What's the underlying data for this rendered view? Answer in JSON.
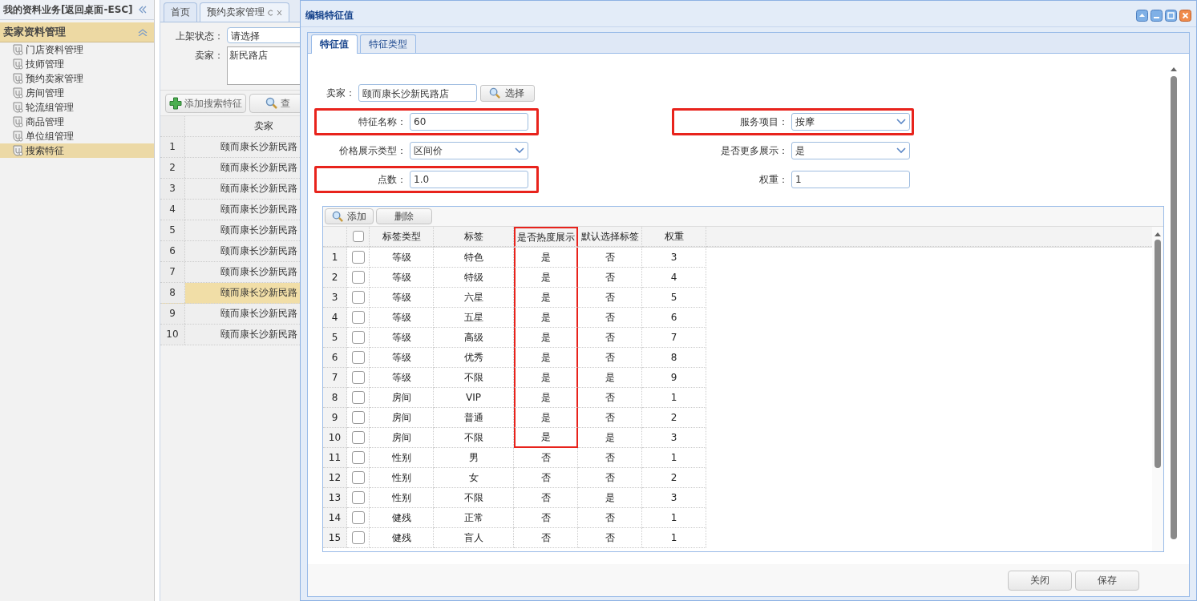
{
  "sidebar": {
    "title": "我的资料业务[返回桌面-ESC]",
    "section": "卖家资料管理",
    "items": [
      {
        "label": "门店资料管理",
        "selected": false
      },
      {
        "label": "技师管理",
        "selected": false
      },
      {
        "label": "预约卖家管理",
        "selected": false
      },
      {
        "label": "房间管理",
        "selected": false
      },
      {
        "label": "轮流组管理",
        "selected": false
      },
      {
        "label": "商品管理",
        "selected": false
      },
      {
        "label": "单位组管理",
        "selected": false
      },
      {
        "label": "搜索特征",
        "selected": true
      }
    ]
  },
  "main": {
    "tabs": [
      {
        "label": "首页",
        "selected": false,
        "closable": false
      },
      {
        "label": "预约卖家管理",
        "selected": true,
        "closable": true
      }
    ],
    "filters": [
      {
        "label": "上架状态：",
        "kind": "select",
        "value": "请选择"
      },
      {
        "label": "卖家：",
        "kind": "textarea",
        "value": "新民路店"
      }
    ],
    "toolbar": [
      {
        "label": "添加搜索特征",
        "kind": "add"
      },
      {
        "label": "查",
        "kind": "search"
      }
    ],
    "grid": {
      "columns": [
        "卖家"
      ],
      "rows": [
        {
          "num": "1",
          "cells": [
            "颐而康长沙新民路"
          ],
          "selected": false
        },
        {
          "num": "2",
          "cells": [
            "颐而康长沙新民路"
          ],
          "selected": false
        },
        {
          "num": "3",
          "cells": [
            "颐而康长沙新民路"
          ],
          "selected": false
        },
        {
          "num": "4",
          "cells": [
            "颐而康长沙新民路"
          ],
          "selected": false
        },
        {
          "num": "5",
          "cells": [
            "颐而康长沙新民路"
          ],
          "selected": false
        },
        {
          "num": "6",
          "cells": [
            "颐而康长沙新民路"
          ],
          "selected": false
        },
        {
          "num": "7",
          "cells": [
            "颐而康长沙新民路"
          ],
          "selected": false
        },
        {
          "num": "8",
          "cells": [
            "颐而康长沙新民路"
          ],
          "selected": true
        },
        {
          "num": "9",
          "cells": [
            "颐而康长沙新民路"
          ],
          "selected": false
        },
        {
          "num": "10",
          "cells": [
            "颐而康长沙新民路"
          ],
          "selected": false
        }
      ]
    }
  },
  "dialog": {
    "title": "编辑特征值",
    "tabs": [
      {
        "label": "特征值",
        "selected": true
      },
      {
        "label": "特征类型",
        "selected": false
      }
    ],
    "form": [
      [
        {
          "label": "卖家：",
          "kind": "input",
          "value": "颐而康长沙新民路店",
          "button": "选择",
          "highlighted": false
        }
      ],
      [
        {
          "label": "特征名称：",
          "kind": "input",
          "value": "60",
          "highlighted": true
        },
        {
          "label": "服务项目：",
          "kind": "select",
          "value": "按摩",
          "highlighted": true
        }
      ],
      [
        {
          "label": "价格展示类型：",
          "kind": "select",
          "value": "区间价",
          "highlighted": false
        },
        {
          "label": "是否更多展示：",
          "kind": "select",
          "value": "是",
          "highlighted": false
        }
      ],
      [
        {
          "label": "点数：",
          "kind": "input",
          "value": "1.0",
          "highlighted": true
        },
        {
          "label": "权重：",
          "kind": "input",
          "value": "1",
          "highlighted": false
        }
      ]
    ],
    "grid": {
      "toolbar": [
        {
          "label": "添加",
          "kind": "search"
        },
        {
          "label": "删除",
          "kind": "plain"
        }
      ],
      "select_all_checked": false,
      "columns": [
        {
          "label": "标签类型",
          "highlighted": false
        },
        {
          "label": "标签",
          "highlighted": false
        },
        {
          "label": "是否热度展示",
          "highlighted": true
        },
        {
          "label": "默认选择标签",
          "highlighted": false
        },
        {
          "label": "权重",
          "highlighted": false
        }
      ],
      "rows": [
        {
          "num": "1",
          "checked": false,
          "highlighted": true,
          "cells": [
            "等级",
            "特色",
            "是",
            "否",
            "3"
          ]
        },
        {
          "num": "2",
          "checked": false,
          "highlighted": true,
          "cells": [
            "等级",
            "特级",
            "是",
            "否",
            "4"
          ]
        },
        {
          "num": "3",
          "checked": false,
          "highlighted": true,
          "cells": [
            "等级",
            "六星",
            "是",
            "否",
            "5"
          ]
        },
        {
          "num": "4",
          "checked": false,
          "highlighted": true,
          "cells": [
            "等级",
            "五星",
            "是",
            "否",
            "6"
          ]
        },
        {
          "num": "5",
          "checked": false,
          "highlighted": true,
          "cells": [
            "等级",
            "高级",
            "是",
            "否",
            "7"
          ]
        },
        {
          "num": "6",
          "checked": false,
          "highlighted": true,
          "cells": [
            "等级",
            "优秀",
            "是",
            "否",
            "8"
          ]
        },
        {
          "num": "7",
          "checked": false,
          "highlighted": true,
          "cells": [
            "等级",
            "不限",
            "是",
            "是",
            "9"
          ]
        },
        {
          "num": "8",
          "checked": false,
          "highlighted": true,
          "cells": [
            "房间",
            "VIP",
            "是",
            "否",
            "1"
          ]
        },
        {
          "num": "9",
          "checked": false,
          "highlighted": true,
          "cells": [
            "房间",
            "普通",
            "是",
            "否",
            "2"
          ]
        },
        {
          "num": "10",
          "checked": false,
          "highlighted": true,
          "cells": [
            "房间",
            "不限",
            "是",
            "是",
            "3"
          ]
        },
        {
          "num": "11",
          "checked": false,
          "highlighted": false,
          "cells": [
            "性别",
            "男",
            "否",
            "否",
            "1"
          ]
        },
        {
          "num": "12",
          "checked": false,
          "highlighted": false,
          "cells": [
            "性别",
            "女",
            "否",
            "否",
            "2"
          ]
        },
        {
          "num": "13",
          "checked": false,
          "highlighted": false,
          "cells": [
            "性别",
            "不限",
            "否",
            "是",
            "3"
          ]
        },
        {
          "num": "14",
          "checked": false,
          "highlighted": false,
          "cells": [
            "健残",
            "正常",
            "否",
            "否",
            "1"
          ]
        },
        {
          "num": "15",
          "checked": false,
          "highlighted": false,
          "cells": [
            "健残",
            "盲人",
            "否",
            "否",
            "1"
          ]
        }
      ]
    },
    "buttons": [
      "关闭",
      "保存"
    ]
  }
}
